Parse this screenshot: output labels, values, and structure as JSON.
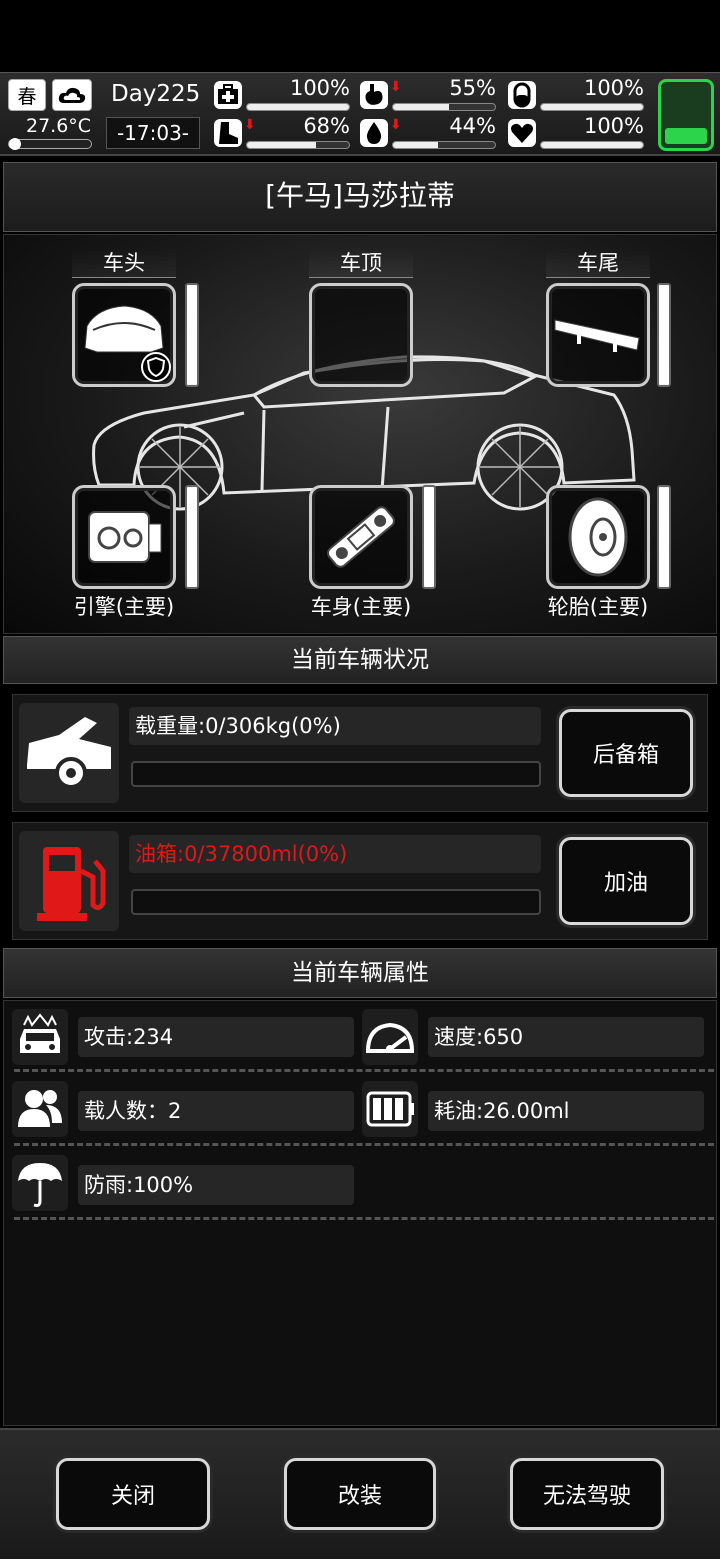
{
  "status": {
    "season": "春",
    "temperature": "27.6°C",
    "day": "Day225",
    "time": "-17:03-",
    "stats": [
      {
        "name": "health",
        "value": "100%",
        "level": 1.0,
        "down": false
      },
      {
        "name": "hunger",
        "value": "55%",
        "level": 0.55,
        "down": true
      },
      {
        "name": "energy",
        "value": "100%",
        "level": 1.0,
        "down": false
      },
      {
        "name": "stamina",
        "value": "68%",
        "level": 0.68,
        "down": true
      },
      {
        "name": "thirst",
        "value": "44%",
        "level": 0.44,
        "down": true
      },
      {
        "name": "mood",
        "value": "100%",
        "level": 1.0,
        "down": false
      }
    ]
  },
  "vehicle": {
    "title": "[午马]马莎拉蒂",
    "slots": {
      "front_title": "车头",
      "roof_title": "车顶",
      "rear_title": "车尾",
      "engine_label": "引擎(主要)",
      "body_label": "车身(主要)",
      "tire_label": "轮胎(主要)"
    }
  },
  "condition": {
    "header": "当前车辆状况",
    "load_text": "载重量:0/306kg(0%)",
    "load_level": 0,
    "trunk_button": "后备箱",
    "fuel_text": "油箱:0/37800ml(0%)",
    "fuel_level": 0,
    "refuel_button": "加油"
  },
  "attributes": {
    "header": "当前车辆属性",
    "attack": "攻击:234",
    "speed": "速度:650",
    "capacity": "载人数：2",
    "fuel_use": "耗油:26.00ml",
    "rain": "防雨:100%"
  },
  "footer": {
    "close": "关闭",
    "modify": "改装",
    "drive": "无法驾驶"
  },
  "colors": {
    "alert": "#e01818",
    "battery": "#2bd44a"
  }
}
